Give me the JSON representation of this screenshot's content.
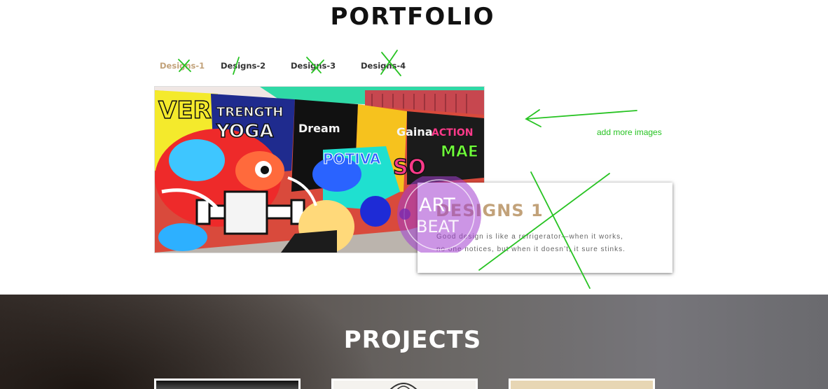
{
  "portfolio": {
    "title": "PORTFOLIO",
    "tabs": [
      "Designs-1",
      "Designs-2",
      "Designs-3",
      "Designs-4"
    ],
    "active_tab": 0
  },
  "caption": {
    "title": "DESIGNS 1",
    "line1": "Good design is like a refrigerator—when it works,",
    "line2": "no one notices, but when it doesn’t, it sure stinks."
  },
  "hero_image": {
    "logo_text_1": "ART",
    "logo_text_2": "BEAT"
  },
  "annotation": {
    "note": "add more images",
    "color": "#27c322"
  },
  "projects": {
    "title": "PROJECTS",
    "thumbnail_count": 3
  },
  "colors": {
    "accent": "#c2a27a",
    "annotation": "#27c322"
  }
}
